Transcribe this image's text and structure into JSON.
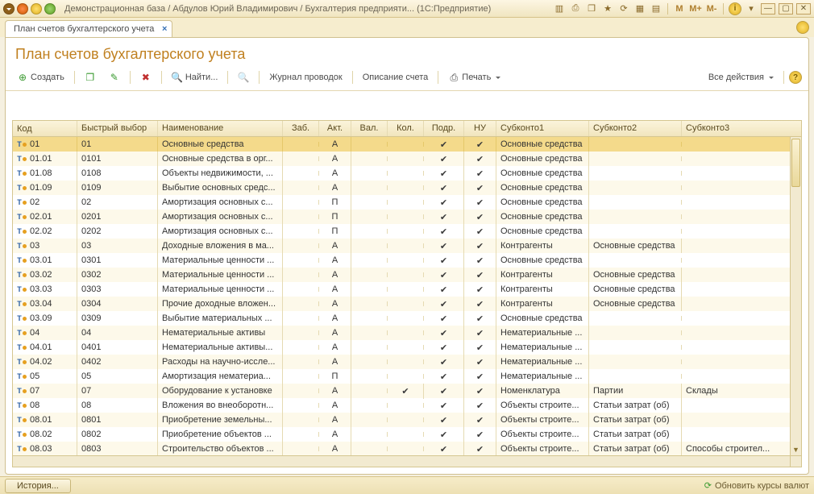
{
  "titlebar": {
    "text": "Демонстрационная база / Абдулов Юрий Владимирович / Бухгалтерия предприяти...   (1С:Предприятие)",
    "m_buttons": [
      "M",
      "M+",
      "M-"
    ]
  },
  "tab": {
    "label": "План счетов бухгалтерского учета"
  },
  "header": {
    "title": "План счетов бухгалтерского учета"
  },
  "toolbar": {
    "create": "Создать",
    "find": "Найти...",
    "journal": "Журнал проводок",
    "desc": "Описание счета",
    "print": "Печать",
    "all_actions": "Все действия"
  },
  "columns": {
    "code": "Код",
    "fast": "Быстрый выбор",
    "name": "Наименование",
    "zab": "Заб.",
    "akt": "Акт.",
    "val": "Вал.",
    "kol": "Кол.",
    "podr": "Подр.",
    "nu": "НУ",
    "sub1": "Субконто1",
    "sub2": "Субконто2",
    "sub3": "Субконто3"
  },
  "rows": [
    {
      "code": "01",
      "fast": "01",
      "name": "Основные средства",
      "akt": "А",
      "podr": true,
      "nu": true,
      "sub1": "Основные средства",
      "sub2": "",
      "sub3": "",
      "selected": true
    },
    {
      "code": "01.01",
      "fast": "0101",
      "name": "Основные средства в орг...",
      "akt": "А",
      "podr": true,
      "nu": true,
      "sub1": "Основные средства",
      "sub2": "",
      "sub3": ""
    },
    {
      "code": "01.08",
      "fast": "0108",
      "name": "Объекты недвижимости, ...",
      "akt": "А",
      "podr": true,
      "nu": true,
      "sub1": "Основные средства",
      "sub2": "",
      "sub3": ""
    },
    {
      "code": "01.09",
      "fast": "0109",
      "name": "Выбытие основных средс...",
      "akt": "А",
      "podr": true,
      "nu": true,
      "sub1": "Основные средства",
      "sub2": "",
      "sub3": ""
    },
    {
      "code": "02",
      "fast": "02",
      "name": "Амортизация основных с...",
      "akt": "П",
      "podr": true,
      "nu": true,
      "sub1": "Основные средства",
      "sub2": "",
      "sub3": ""
    },
    {
      "code": "02.01",
      "fast": "0201",
      "name": "Амортизация основных с...",
      "akt": "П",
      "podr": true,
      "nu": true,
      "sub1": "Основные средства",
      "sub2": "",
      "sub3": ""
    },
    {
      "code": "02.02",
      "fast": "0202",
      "name": "Амортизация основных с...",
      "akt": "П",
      "podr": true,
      "nu": true,
      "sub1": "Основные средства",
      "sub2": "",
      "sub3": ""
    },
    {
      "code": "03",
      "fast": "03",
      "name": "Доходные вложения в ма...",
      "akt": "А",
      "podr": true,
      "nu": true,
      "sub1": "Контрагенты",
      "sub2": "Основные средства",
      "sub3": ""
    },
    {
      "code": "03.01",
      "fast": "0301",
      "name": "Материальные ценности ...",
      "akt": "А",
      "podr": true,
      "nu": true,
      "sub1": "Основные средства",
      "sub2": "",
      "sub3": ""
    },
    {
      "code": "03.02",
      "fast": "0302",
      "name": "Материальные ценности ...",
      "akt": "А",
      "podr": true,
      "nu": true,
      "sub1": "Контрагенты",
      "sub2": "Основные средства",
      "sub3": ""
    },
    {
      "code": "03.03",
      "fast": "0303",
      "name": "Материальные ценности ...",
      "akt": "А",
      "podr": true,
      "nu": true,
      "sub1": "Контрагенты",
      "sub2": "Основные средства",
      "sub3": ""
    },
    {
      "code": "03.04",
      "fast": "0304",
      "name": "Прочие доходные вложен...",
      "akt": "А",
      "podr": true,
      "nu": true,
      "sub1": "Контрагенты",
      "sub2": "Основные средства",
      "sub3": ""
    },
    {
      "code": "03.09",
      "fast": "0309",
      "name": "Выбытие материальных ...",
      "akt": "А",
      "podr": true,
      "nu": true,
      "sub1": "Основные средства",
      "sub2": "",
      "sub3": ""
    },
    {
      "code": "04",
      "fast": "04",
      "name": "Нематериальные активы",
      "akt": "А",
      "podr": true,
      "nu": true,
      "sub1": "Нематериальные ...",
      "sub2": "",
      "sub3": ""
    },
    {
      "code": "04.01",
      "fast": "0401",
      "name": "Нематериальные активы...",
      "akt": "А",
      "podr": true,
      "nu": true,
      "sub1": "Нематериальные ...",
      "sub2": "",
      "sub3": ""
    },
    {
      "code": "04.02",
      "fast": "0402",
      "name": "Расходы на научно-иссле...",
      "akt": "А",
      "podr": true,
      "nu": true,
      "sub1": "Нематериальные ...",
      "sub2": "",
      "sub3": ""
    },
    {
      "code": "05",
      "fast": "05",
      "name": "Амортизация нематериа...",
      "akt": "П",
      "podr": true,
      "nu": true,
      "sub1": "Нематериальные ...",
      "sub2": "",
      "sub3": ""
    },
    {
      "code": "07",
      "fast": "07",
      "name": "Оборудование к установке",
      "akt": "А",
      "kol": true,
      "podr": true,
      "nu": true,
      "sub1": "Номенклатура",
      "sub2": "Партии",
      "sub3": "Склады"
    },
    {
      "code": "08",
      "fast": "08",
      "name": "Вложения во внеоборотн...",
      "akt": "А",
      "podr": true,
      "nu": true,
      "sub1": "Объекты строите...",
      "sub2": "Статьи затрат (об)",
      "sub3": ""
    },
    {
      "code": "08.01",
      "fast": "0801",
      "name": "Приобретение земельны...",
      "akt": "А",
      "podr": true,
      "nu": true,
      "sub1": "Объекты строите...",
      "sub2": "Статьи затрат (об)",
      "sub3": ""
    },
    {
      "code": "08.02",
      "fast": "0802",
      "name": "Приобретение объектов ...",
      "akt": "А",
      "podr": true,
      "nu": true,
      "sub1": "Объекты строите...",
      "sub2": "Статьи затрат (об)",
      "sub3": ""
    },
    {
      "code": "08.03",
      "fast": "0803",
      "name": "Строительство объектов ...",
      "akt": "А",
      "podr": true,
      "nu": true,
      "sub1": "Объекты строите...",
      "sub2": "Статьи затрат (об)",
      "sub3": "Способы строител..."
    }
  ],
  "statusbar": {
    "history": "История...",
    "refresh": "Обновить курсы валют"
  }
}
